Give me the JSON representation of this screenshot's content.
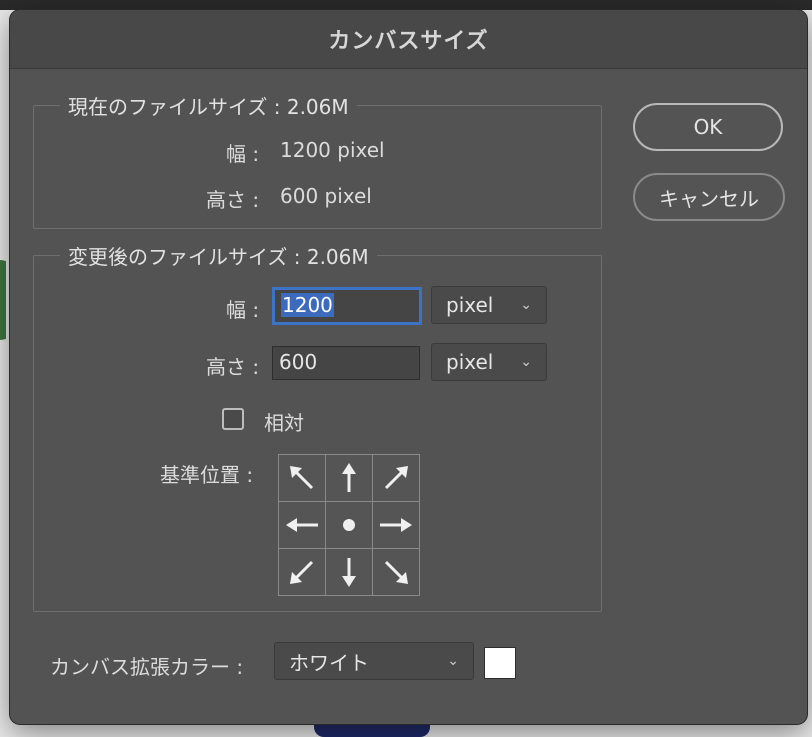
{
  "dialog": {
    "title": "カンバスサイズ"
  },
  "current": {
    "legend": "現在のファイルサイズ : 2.06M",
    "width_label": "幅 :",
    "width_value": "1200 pixel",
    "height_label": "高さ :",
    "height_value": "600 pixel"
  },
  "new_size": {
    "legend": "変更後のファイルサイズ : 2.06M",
    "width_label": "幅 :",
    "width_input": "1200",
    "width_unit": "pixel",
    "height_label": "高さ :",
    "height_input": "600",
    "height_unit": "pixel",
    "relative_label": "相対",
    "relative_checked": false,
    "anchor_label": "基準位置 :",
    "anchor_icons": [
      "arrow-up-left-icon",
      "arrow-up-icon",
      "arrow-up-right-icon",
      "arrow-left-icon",
      "anchor-center-dot-icon",
      "arrow-right-icon",
      "arrow-down-left-icon",
      "arrow-down-icon",
      "arrow-down-right-icon"
    ]
  },
  "extension": {
    "label": "カンバス拡張カラー :",
    "selected": "ホワイト",
    "swatch_color": "#ffffff"
  },
  "buttons": {
    "ok": "OK",
    "cancel": "キャンセル"
  },
  "colors": {
    "dialog_bg": "#535353",
    "focus_accent": "#3d73c6"
  }
}
